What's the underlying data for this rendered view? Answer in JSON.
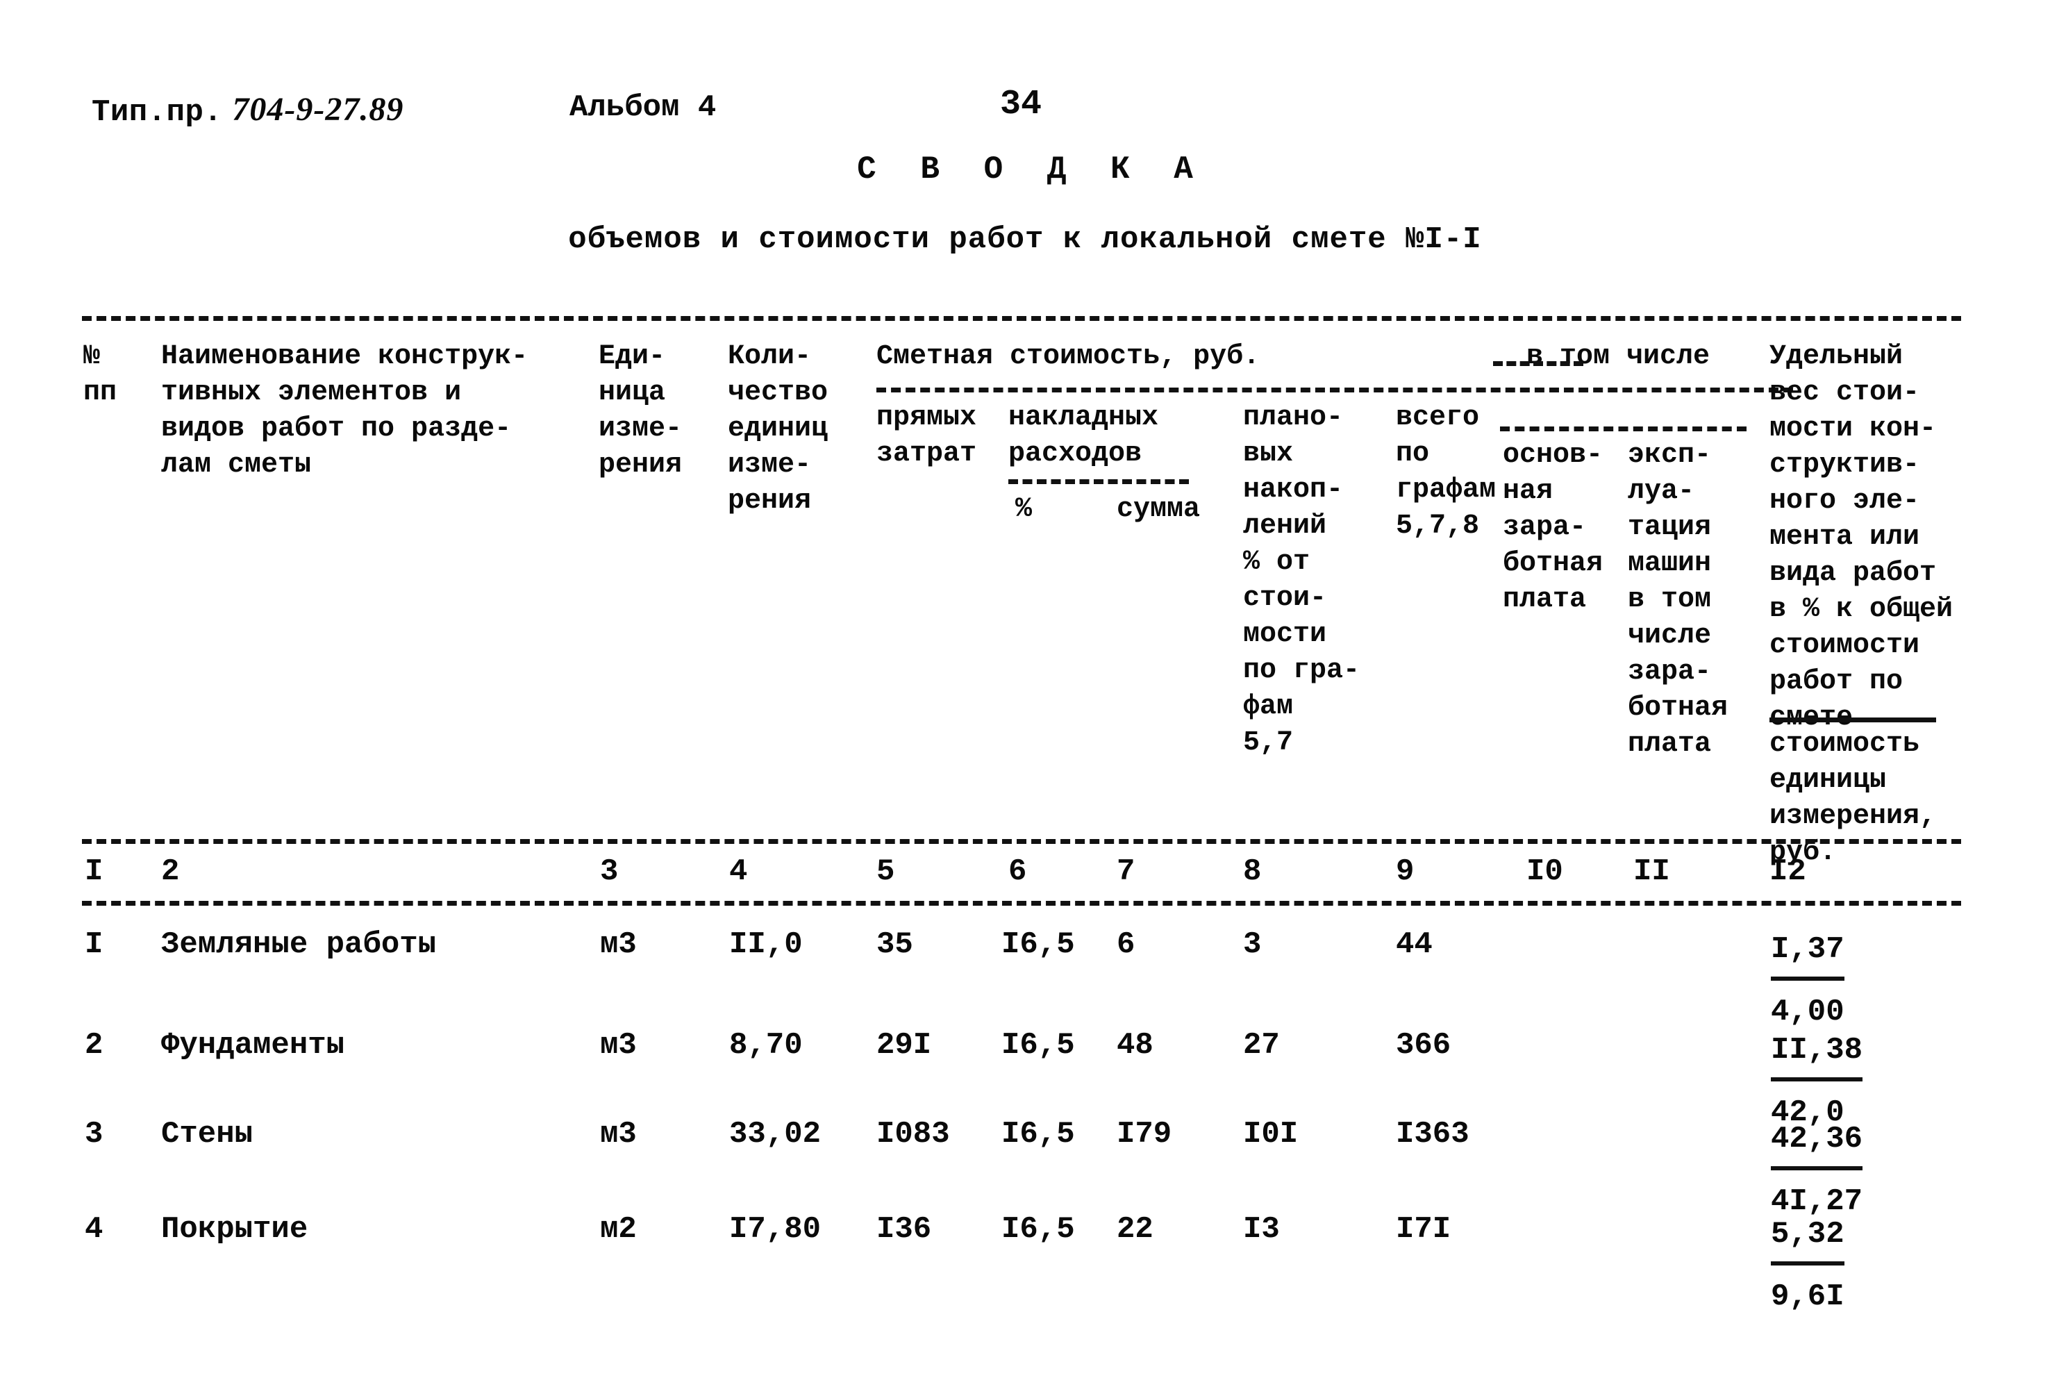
{
  "header": {
    "project_label": "Тип.пр.",
    "project_code": "704-9-27.89",
    "album": "Альбом 4",
    "page_number": "34"
  },
  "title": "С В О Д К А",
  "subtitle": "объемов и стоимости работ к локальной смете №I-I",
  "table": {
    "headers": {
      "col1": "№\nпп",
      "col2": "Наименование конструк-\nтивных элементов и\nвидов работ по разде-\nлам сметы",
      "col3": "Еди-\nница\nизме-\nрения",
      "col4": "Коли-\nчество\nединиц\nизме-\nрения",
      "group_cost": "Сметная стоимость, руб.",
      "col5": "прямых\nзатрат",
      "col6_7_group": "накладных\nрасходов",
      "col6": "%",
      "col7": "сумма",
      "col8": "плано-\nвых\nнакоп-\nлений\n% от\nстои-\nмости\nпо гра-\nфам\n5,7",
      "col9": "всего\nпо\nграфам\n5,7,8",
      "group_in_total": "в том числе",
      "col10": "основ-\nная\nзара-\nботная\nплата",
      "col11": "эксп-\nлуа-\nтация\nмашин\nв том\nчисле\nзара-\nботная\nплата",
      "col12_top": "Удельный\nвес стои-\nмости кон-\nструктив-\nного эле-\nмента или\nвида работ\nв % к общей\nстоимости\nработ по\nсмете",
      "col12_bottom": "стоимость\nединицы\nизмерения,\nруб."
    },
    "column_numbers": [
      "I",
      "2",
      "3",
      "4",
      "5",
      "6",
      "7",
      "8",
      "9",
      "I0",
      "II",
      "I2"
    ],
    "rows": [
      {
        "no": "I",
        "name": "Земляные работы",
        "unit": "м3",
        "quantity": "II,0",
        "direct": "35",
        "overhead_pct": "I6,5",
        "overhead_sum": "6",
        "savings": "3",
        "total": "44",
        "basic_wage": "",
        "machines": "",
        "share_pct": "I,37",
        "unit_cost": "4,00"
      },
      {
        "no": "2",
        "name": "Фундаменты",
        "unit": "м3",
        "quantity": "8,70",
        "direct": "29I",
        "overhead_pct": "I6,5",
        "overhead_sum": "48",
        "savings": "27",
        "total": "366",
        "basic_wage": "",
        "machines": "",
        "share_pct": "II,38",
        "unit_cost": "42,0"
      },
      {
        "no": "3",
        "name": "Стены",
        "unit": "м3",
        "quantity": "33,02",
        "direct": "I083",
        "overhead_pct": "I6,5",
        "overhead_sum": "I79",
        "savings": "I0I",
        "total": "I363",
        "basic_wage": "",
        "machines": "",
        "share_pct": "42,36",
        "unit_cost": "4I,27"
      },
      {
        "no": "4",
        "name": "Покрытие",
        "unit": "м2",
        "quantity": "I7,80",
        "direct": "I36",
        "overhead_pct": "I6,5",
        "overhead_sum": "22",
        "savings": "I3",
        "total": "I7I",
        "basic_wage": "",
        "machines": "",
        "share_pct": "5,32",
        "unit_cost": "9,6I"
      }
    ]
  }
}
